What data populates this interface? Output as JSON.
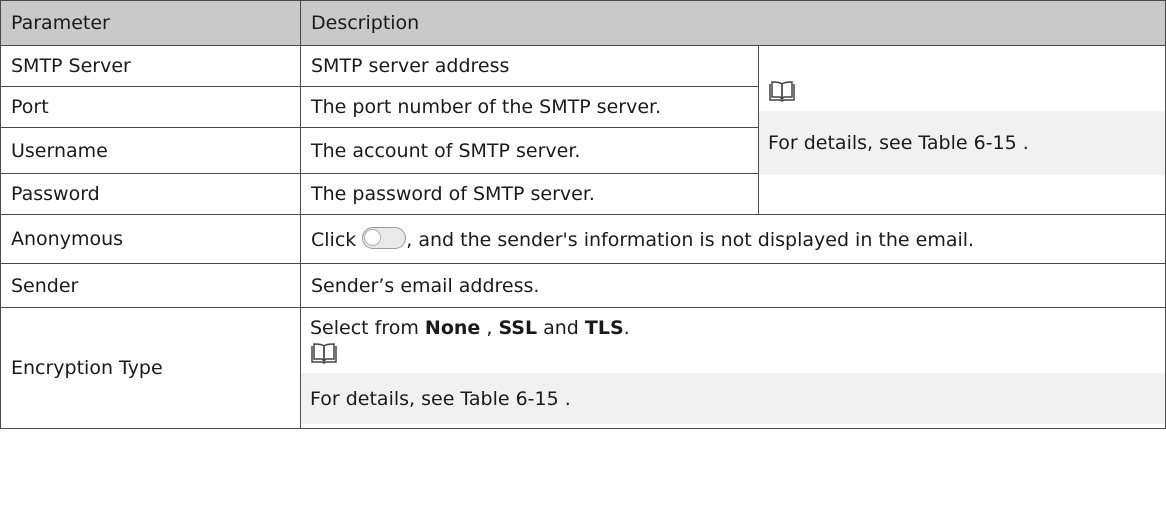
{
  "header": {
    "parameter": "Parameter",
    "description": "Description"
  },
  "rows": [
    {
      "parameter": "SMTP Server",
      "description": "SMTP server address"
    },
    {
      "parameter": "Port",
      "description": "The port number of the SMTP server."
    },
    {
      "parameter": "Username",
      "description": "The account of SMTP server."
    },
    {
      "parameter": "Password",
      "description": "The password of SMTP server."
    }
  ],
  "merged_note": {
    "icon": "book-icon",
    "text": "For details, see Table 6-15 ."
  },
  "anonymous": {
    "parameter": "Anonymous",
    "click_text": "Click",
    "toggle_icon": "toggle-switch-off",
    "rest_text": ", and the sender's information is not displayed in the email."
  },
  "sender": {
    "parameter": "Sender",
    "description": "Sender’s email address."
  },
  "encryption": {
    "parameter": "Encryption Type",
    "intro": "Select from",
    "opt_none": "None",
    "sep1": ",",
    "opt_ssl": "SSL",
    "and": "and",
    "opt_tls": "TLS",
    "period": ".",
    "note_icon": "book-icon",
    "note_text": "For details, see Table 6-15 ."
  }
}
